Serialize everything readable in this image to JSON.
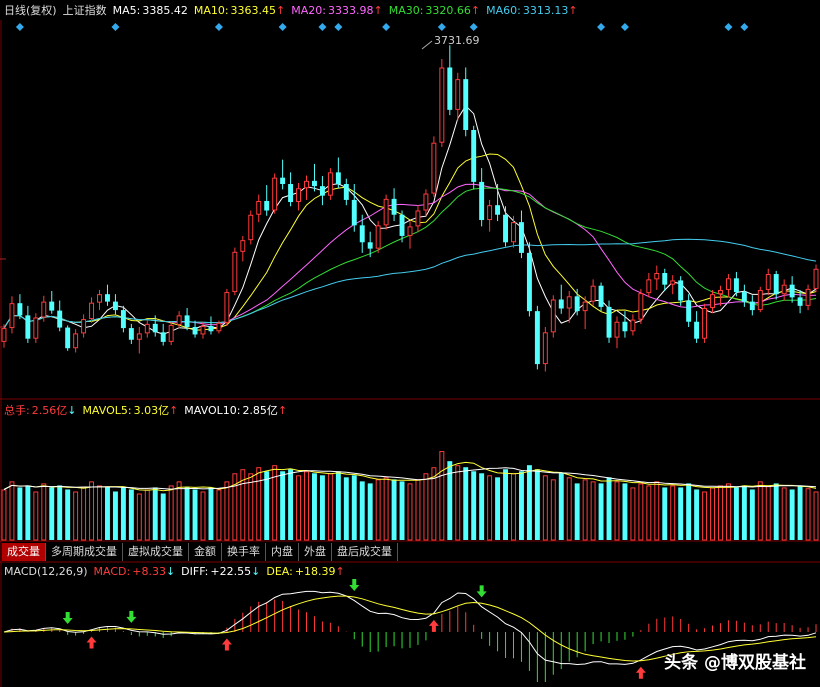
{
  "colors": {
    "up": "#ff3b3b",
    "down": "#54ffff",
    "ma5": "#ffffff",
    "ma10": "#ffff33",
    "ma20": "#ff66ff",
    "ma30": "#33dd33",
    "ma60": "#44ccee",
    "diamond": "#33aaee",
    "grid": "#7a0000"
  },
  "price_header": {
    "chart_label": "日线(复权)",
    "index_name": "上证指数",
    "ma5_label": "MA5:",
    "ma5_value": "3385.42",
    "ma10_label": "MA10:",
    "ma10_value": "3363.45",
    "ma20_label": "MA20:",
    "ma20_value": "3333.98",
    "ma30_label": "MA30:",
    "ma30_value": "3320.66",
    "ma60_label": "MA60:",
    "ma60_value": "3313.13",
    "arrow": "↑"
  },
  "peak_label": "3731.69",
  "volume_header": {
    "total_label": "总手:",
    "total_value": "2.56亿",
    "total_arrow": "↓",
    "mavol5_label": "MAVOL5:",
    "mavol5_value": "3.03亿",
    "mavol5_arrow": "↑",
    "mavol10_label": "MAVOL10:",
    "mavol10_value": "2.85亿",
    "mavol10_arrow": "↑"
  },
  "tabs": [
    "成交量",
    "多周期成交量",
    "虚拟成交量",
    "金额",
    "换手率",
    "内盘",
    "外盘",
    "盘后成交量"
  ],
  "macd_header": {
    "params": "MACD(12,26,9)",
    "macd_label": "MACD:",
    "macd_value": "+8.33",
    "macd_arrow": "↓",
    "diff_label": "DIFF:",
    "diff_value": "+22.55",
    "diff_arrow": "↓",
    "dea_label": "DEA:",
    "dea_value": "+18.39",
    "dea_arrow": "↑"
  },
  "watermark": "头条 @博双股基社",
  "chart_data": {
    "type": "candlestick",
    "candles": [
      [
        3172,
        3205,
        3161,
        3198
      ],
      [
        3198,
        3258,
        3188,
        3245
      ],
      [
        3245,
        3262,
        3215,
        3222
      ],
      [
        3222,
        3240,
        3170,
        3178
      ],
      [
        3178,
        3226,
        3170,
        3218
      ],
      [
        3218,
        3259,
        3210,
        3248
      ],
      [
        3248,
        3268,
        3225,
        3231
      ],
      [
        3231,
        3250,
        3192,
        3199
      ],
      [
        3199,
        3203,
        3155,
        3160
      ],
      [
        3160,
        3196,
        3152,
        3188
      ],
      [
        3188,
        3224,
        3180,
        3215
      ],
      [
        3215,
        3256,
        3208,
        3246
      ],
      [
        3246,
        3270,
        3232,
        3262
      ],
      [
        3262,
        3280,
        3240,
        3248
      ],
      [
        3248,
        3262,
        3224,
        3232
      ],
      [
        3232,
        3240,
        3190,
        3198
      ],
      [
        3198,
        3206,
        3168,
        3176
      ],
      [
        3176,
        3200,
        3150,
        3188
      ],
      [
        3188,
        3212,
        3180,
        3206
      ],
      [
        3206,
        3222,
        3182,
        3190
      ],
      [
        3190,
        3206,
        3165,
        3172
      ],
      [
        3172,
        3210,
        3166,
        3204
      ],
      [
        3204,
        3230,
        3198,
        3222
      ],
      [
        3222,
        3236,
        3194,
        3200
      ],
      [
        3200,
        3212,
        3180,
        3186
      ],
      [
        3186,
        3210,
        3178,
        3202
      ],
      [
        3202,
        3220,
        3186,
        3192
      ],
      [
        3192,
        3212,
        3188,
        3208
      ],
      [
        3208,
        3272,
        3202,
        3266
      ],
      [
        3266,
        3350,
        3260,
        3342
      ],
      [
        3342,
        3372,
        3324,
        3364
      ],
      [
        3364,
        3420,
        3356,
        3412
      ],
      [
        3412,
        3450,
        3398,
        3438
      ],
      [
        3438,
        3468,
        3410,
        3420
      ],
      [
        3420,
        3490,
        3414,
        3482
      ],
      [
        3482,
        3516,
        3460,
        3470
      ],
      [
        3470,
        3492,
        3428,
        3436
      ],
      [
        3436,
        3472,
        3420,
        3462
      ],
      [
        3462,
        3486,
        3440,
        3476
      ],
      [
        3476,
        3508,
        3456,
        3466
      ],
      [
        3466,
        3485,
        3430,
        3448
      ],
      [
        3448,
        3500,
        3440,
        3492
      ],
      [
        3492,
        3520,
        3462,
        3470
      ],
      [
        3470,
        3480,
        3430,
        3440
      ],
      [
        3440,
        3470,
        3380,
        3392
      ],
      [
        3392,
        3412,
        3340,
        3360
      ],
      [
        3360,
        3380,
        3332,
        3348
      ],
      [
        3348,
        3400,
        3340,
        3392
      ],
      [
        3392,
        3450,
        3384,
        3442
      ],
      [
        3442,
        3462,
        3400,
        3412
      ],
      [
        3412,
        3420,
        3360,
        3372
      ],
      [
        3372,
        3400,
        3348,
        3390
      ],
      [
        3390,
        3430,
        3380,
        3420
      ],
      [
        3420,
        3460,
        3410,
        3452
      ],
      [
        3452,
        3560,
        3446,
        3548
      ],
      [
        3548,
        3706,
        3540,
        3690
      ],
      [
        3690,
        3732,
        3600,
        3610
      ],
      [
        3610,
        3680,
        3590,
        3668
      ],
      [
        3668,
        3690,
        3560,
        3572
      ],
      [
        3572,
        3580,
        3460,
        3474
      ],
      [
        3474,
        3500,
        3390,
        3402
      ],
      [
        3402,
        3440,
        3380,
        3430
      ],
      [
        3430,
        3470,
        3400,
        3412
      ],
      [
        3412,
        3428,
        3352,
        3360
      ],
      [
        3360,
        3410,
        3350,
        3398
      ],
      [
        3398,
        3420,
        3330,
        3340
      ],
      [
        3340,
        3360,
        3220,
        3230
      ],
      [
        3230,
        3240,
        3120,
        3130
      ],
      [
        3130,
        3200,
        3116,
        3190
      ],
      [
        3190,
        3260,
        3180,
        3252
      ],
      [
        3252,
        3280,
        3225,
        3235
      ],
      [
        3235,
        3268,
        3208,
        3258
      ],
      [
        3258,
        3272,
        3222,
        3230
      ],
      [
        3230,
        3258,
        3196,
        3248
      ],
      [
        3248,
        3290,
        3240,
        3278
      ],
      [
        3278,
        3284,
        3230,
        3238
      ],
      [
        3238,
        3250,
        3170,
        3180
      ],
      [
        3180,
        3220,
        3160,
        3210
      ],
      [
        3210,
        3230,
        3180,
        3192
      ],
      [
        3192,
        3224,
        3184,
        3214
      ],
      [
        3214,
        3272,
        3206,
        3264
      ],
      [
        3264,
        3302,
        3256,
        3290
      ],
      [
        3290,
        3316,
        3270,
        3302
      ],
      [
        3302,
        3310,
        3268,
        3280
      ],
      [
        3280,
        3298,
        3262,
        3288
      ],
      [
        3288,
        3296,
        3240,
        3250
      ],
      [
        3250,
        3262,
        3200,
        3210
      ],
      [
        3210,
        3230,
        3170,
        3178
      ],
      [
        3178,
        3244,
        3170,
        3236
      ],
      [
        3236,
        3270,
        3226,
        3262
      ],
      [
        3262,
        3278,
        3240,
        3270
      ],
      [
        3270,
        3300,
        3256,
        3292
      ],
      [
        3292,
        3304,
        3258,
        3266
      ],
      [
        3266,
        3280,
        3238,
        3248
      ],
      [
        3248,
        3260,
        3222,
        3232
      ],
      [
        3232,
        3276,
        3228,
        3270
      ],
      [
        3270,
        3310,
        3260,
        3300
      ],
      [
        3300,
        3306,
        3252,
        3262
      ],
      [
        3262,
        3290,
        3250,
        3280
      ],
      [
        3280,
        3296,
        3246,
        3256
      ],
      [
        3256,
        3270,
        3226,
        3240
      ],
      [
        3240,
        3280,
        3232,
        3272
      ],
      [
        3272,
        3318,
        3266,
        3310
      ]
    ],
    "volume": [
      2.5,
      2.9,
      2.6,
      2.7,
      2.4,
      2.8,
      2.6,
      2.7,
      2.5,
      2.4,
      2.6,
      2.9,
      2.7,
      2.6,
      2.4,
      2.6,
      2.5,
      2.3,
      2.5,
      2.6,
      2.3,
      2.7,
      2.9,
      2.6,
      2.5,
      2.4,
      2.6,
      2.5,
      2.9,
      3.3,
      3.5,
      3.3,
      3.6,
      3.4,
      3.7,
      3.4,
      3.5,
      3.2,
      3.4,
      3.3,
      3.2,
      3.3,
      3.4,
      3.1,
      3.2,
      2.9,
      2.8,
      3.0,
      3.1,
      3.0,
      2.9,
      2.8,
      3.0,
      3.3,
      3.6,
      4.4,
      3.9,
      3.7,
      3.6,
      3.4,
      3.3,
      3.2,
      3.1,
      3.5,
      3.3,
      3.4,
      3.7,
      3.5,
      3.2,
      3.0,
      3.3,
      3.1,
      2.8,
      3.0,
      2.9,
      2.8,
      3.1,
      2.9,
      2.8,
      2.6,
      2.8,
      2.7,
      2.9,
      2.6,
      2.7,
      2.6,
      2.8,
      2.5,
      2.4,
      2.6,
      2.7,
      2.8,
      2.6,
      2.7,
      2.5,
      2.9,
      2.7,
      2.8,
      2.6,
      2.5,
      2.7,
      2.56,
      2.4
    ]
  }
}
